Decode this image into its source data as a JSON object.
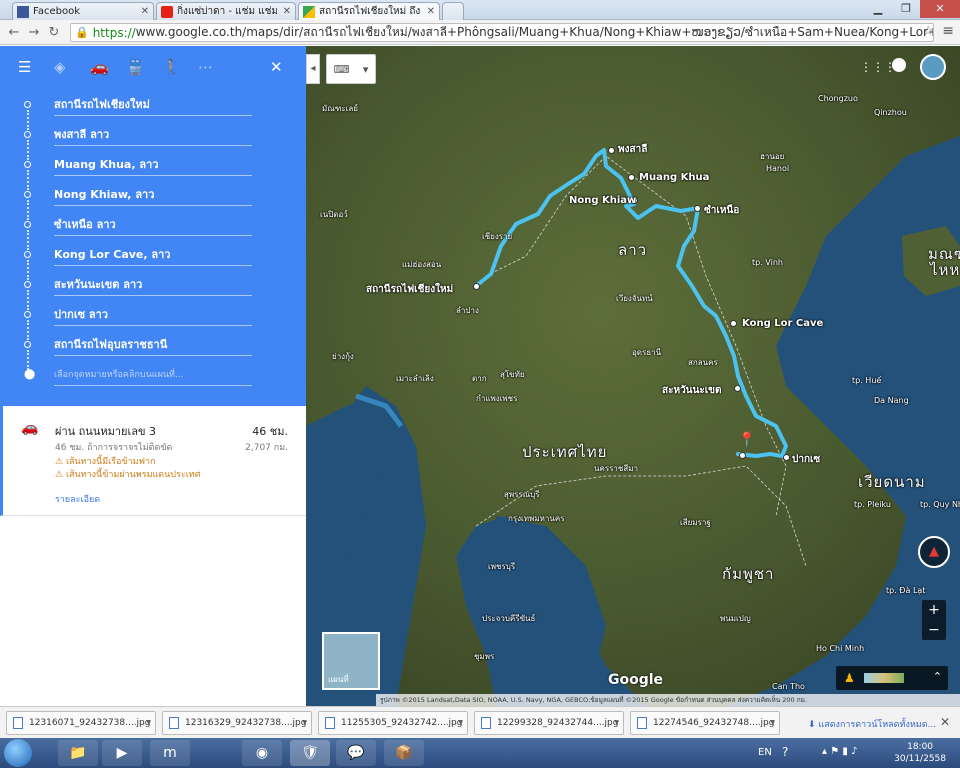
{
  "browser": {
    "tabs": [
      {
        "label": "Facebook",
        "icon": "facebook-icon",
        "color": "#3b5998"
      },
      {
        "label": "กิ่งแซ่บ่าดา - แช่ม แช่มรัต...",
        "icon": "youtube-icon",
        "color": "#e62117"
      },
      {
        "label": "สถานีรถไฟเชียงใหม่ ถึง สถานี...",
        "icon": "google-maps-icon",
        "color": "#34a853"
      }
    ],
    "url_scheme": "https://",
    "url_rest": "www.google.co.th/maps/dir/สถานีรถไฟเชียงใหม่/พงสาลี+Phôngsali/Muang+Khua/Nong+Khiaw+ໜອງຂຽວ/ซำเหนือ+Sam+Nuea/Kong+Lor+Cave/สะหวัน"
  },
  "directions": {
    "stops": [
      "สถานีรถไฟเชียงใหม่",
      "พงสาลี ลาว",
      "Muang Khua, ลาว",
      "Nong Khiaw, ลาว",
      "ซำเหนือ ลาว",
      "Kong Lor Cave, ลาว",
      "สะหวันนะเขต ลาว",
      "ปากเซ ลาว",
      "สถานีรถไฟอุบลราชธานี"
    ],
    "destination_placeholder": "เลือกจุดหมายหรือคลิกบนแผนที่...",
    "route": {
      "title": "ผ่าน ถนนหมายเลข 3",
      "time": "46 ชม.",
      "subtitle": "46 ชม. ถ้าการจราจรไม่ติดขัด",
      "distance": "2,707 กม.",
      "warnings": [
        "เส้นทางนี้มีเรือข้ามฟาก",
        "เส้นทางนี้ข้ามผ่านพรมแดนประเทศ"
      ],
      "details_link": "รายละเอียด"
    }
  },
  "map": {
    "labels": [
      {
        "t": "สถานีรถไฟเชียงใหม่",
        "c": "city"
      },
      {
        "t": "พงสาลี",
        "c": "city"
      },
      {
        "t": "Muang Khua",
        "c": "city"
      },
      {
        "t": "Nong Khiaw",
        "c": "city"
      },
      {
        "t": "ซำเหนือ",
        "c": "city"
      },
      {
        "t": "Kong Lor Cave",
        "c": "city"
      },
      {
        "t": "สะหวันนะเขต",
        "c": "city"
      },
      {
        "t": "ปากเซ",
        "c": "city"
      },
      {
        "t": "ลาว",
        "c": "big"
      },
      {
        "t": "ประเทศไทย",
        "c": "big"
      },
      {
        "t": "กัมพูชา",
        "c": "big"
      },
      {
        "t": "เวียดนาม",
        "c": "big"
      },
      {
        "t": "มณฑ",
        "c": "big"
      },
      {
        "t": "ไหหลํ",
        "c": "big"
      },
      {
        "t": "Hanoi",
        "c": ""
      },
      {
        "t": "ฮานอย",
        "c": ""
      },
      {
        "t": "Chongzuo",
        "c": ""
      },
      {
        "t": "Qinzhou",
        "c": ""
      },
      {
        "t": "Ho Chi Minh",
        "c": ""
      },
      {
        "t": "Can Tho",
        "c": ""
      },
      {
        "t": "Da Nang",
        "c": ""
      },
      {
        "t": "tp. Vinh",
        "c": ""
      },
      {
        "t": "เวียงจันทน์",
        "c": ""
      },
      {
        "t": "อุดรธานี",
        "c": ""
      },
      {
        "t": "นครราชสีมา",
        "c": ""
      },
      {
        "t": "กรุงเทพมหานคร",
        "c": ""
      },
      {
        "t": "พนมเปญ",
        "c": ""
      },
      {
        "t": "เนปิดอว์",
        "c": ""
      },
      {
        "t": "มัณฑะเลย์",
        "c": ""
      },
      {
        "t": "เชียงราย",
        "c": ""
      },
      {
        "t": "ลำปาง",
        "c": ""
      },
      {
        "t": "สุโขทัย",
        "c": ""
      },
      {
        "t": "ตาก",
        "c": ""
      },
      {
        "t": "กำแพงเพชร",
        "c": ""
      },
      {
        "t": "สุพรรณบุรี",
        "c": ""
      },
      {
        "t": "เพชรบุรี",
        "c": ""
      },
      {
        "t": "ประจวบคีรีขันธ์",
        "c": ""
      },
      {
        "t": "ชุมพร",
        "c": ""
      },
      {
        "t": "เสียมราฐ",
        "c": ""
      },
      {
        "t": "สกลนคร",
        "c": ""
      },
      {
        "t": "แม่ฮ่องสอน",
        "c": ""
      },
      {
        "t": "ย่างกุ้ง",
        "c": ""
      },
      {
        "t": "tp. Huế",
        "c": ""
      },
      {
        "t": "tp. Pleiku",
        "c": ""
      },
      {
        "t": "tp. Quy Nhơn",
        "c": ""
      },
      {
        "t": "tp. Đà Lạt",
        "c": ""
      },
      {
        "t": "เมาะลำเลิง",
        "c": ""
      }
    ],
    "satellite_label": "แผนที่",
    "google_logo": "Google",
    "attribution": "รูปภาพ ©2015 Landsat,Data SIO, NOAA, U.S. Navy, NGA, GEBCO,ข้อมูลแผนที่ ©2015 Google   ข้อกำหนด   ส่วนบุคคล   ส่งความคิดเห็น   200 กม.",
    "route_color": "#4cc2f1"
  },
  "downloads": {
    "files": [
      "12316071_92432738....jpg",
      "12316329_92432738....jpg",
      "11255305_92432742....jpg",
      "12299328_92432744....jpg",
      "12274546_92432748....jpg"
    ],
    "show_all": "แสดงการดาวน์โหลดทั้งหมด..."
  },
  "taskbar": {
    "lang": "EN",
    "time": "18:00",
    "date": "30/11/2558"
  }
}
